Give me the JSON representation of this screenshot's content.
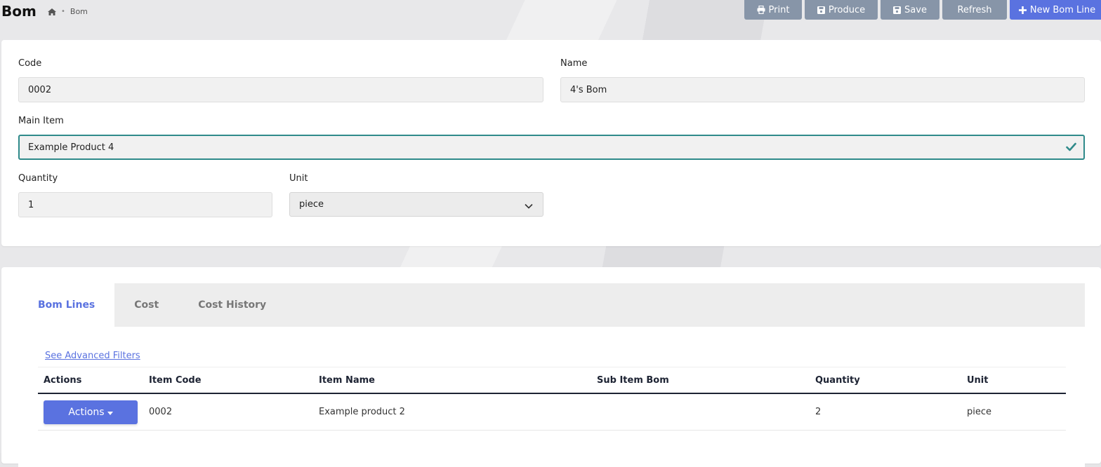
{
  "page": {
    "title": "Bom",
    "breadcrumb": [
      "Bom"
    ]
  },
  "toolbar": {
    "print_label": "Print",
    "produce_label": "Produce",
    "save_label": "Save",
    "refresh_label": "Refresh",
    "new_bom_line_label": "New Bom Line"
  },
  "form": {
    "code_label": "Code",
    "code_value": "0002",
    "name_label": "Name",
    "name_value": "4's Bom",
    "main_item_label": "Main Item",
    "main_item_value": "Example Product 4",
    "quantity_label": "Quantity",
    "quantity_value": "1",
    "unit_label": "Unit",
    "unit_value": "piece"
  },
  "tabs": [
    {
      "label": "Bom Lines",
      "active": true
    },
    {
      "label": "Cost",
      "active": false
    },
    {
      "label": "Cost History",
      "active": false
    }
  ],
  "bom_lines": {
    "advanced_filters_link": "See Advanced Filters",
    "columns": [
      "Actions",
      "Item Code",
      "Item Name",
      "Sub Item Bom",
      "Quantity",
      "Unit"
    ],
    "rows": [
      {
        "actions_label": "Actions",
        "item_code": "0002",
        "item_name": "Example product 2",
        "sub_item_bom": "",
        "quantity": "2",
        "unit": "piece"
      }
    ]
  },
  "colors": {
    "primary": "#5a72e0",
    "toolbar_button": "#8795a8",
    "valid_border": "#2f8a8a",
    "check_icon": "#2f8a8a"
  },
  "icons": {
    "home": "home-icon",
    "print": "print-icon",
    "produce": "save-icon",
    "save": "save-icon",
    "new": "plus-icon",
    "check": "check-icon",
    "chevron": "chevron-down-icon",
    "caret": "caret-down-icon"
  }
}
